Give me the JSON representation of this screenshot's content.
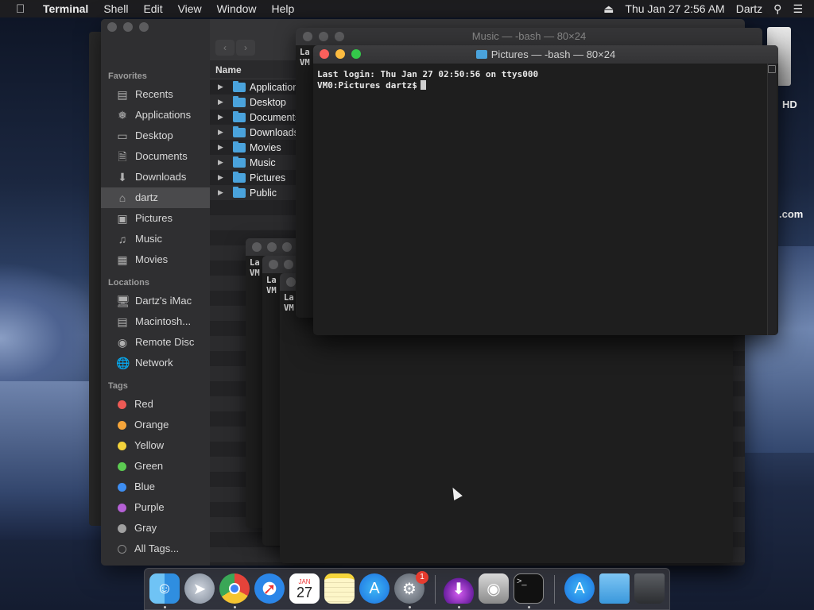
{
  "menubar": {
    "app": "Terminal",
    "menus": [
      "Shell",
      "Edit",
      "View",
      "Window",
      "Help"
    ],
    "clock": "Thu Jan 27  2:56 AM",
    "user": "Dartz"
  },
  "desktop": {
    "labels": [
      "HD",
      ".com"
    ]
  },
  "finder": {
    "column_header": "Name",
    "sidebar": {
      "favorites_header": "Favorites",
      "favorites": [
        "Recents",
        "Applications",
        "Desktop",
        "Documents",
        "Downloads",
        "dartz",
        "Pictures",
        "Music",
        "Movies"
      ],
      "locations_header": "Locations",
      "locations": [
        "Dartz's iMac",
        "Macintosh...",
        "Remote Disc",
        "Network"
      ],
      "tags_header": "Tags",
      "tags": [
        {
          "label": "Red",
          "color": "#ed5a55"
        },
        {
          "label": "Orange",
          "color": "#f5a53a"
        },
        {
          "label": "Yellow",
          "color": "#f3d33b"
        },
        {
          "label": "Green",
          "color": "#5ccb52"
        },
        {
          "label": "Blue",
          "color": "#3e8ef1"
        },
        {
          "label": "Purple",
          "color": "#b560d6"
        },
        {
          "label": "Gray",
          "color": "#a0a0a0"
        }
      ],
      "all_tags": "All Tags..."
    },
    "rows": [
      "Applications",
      "Desktop",
      "Documents",
      "Downloads",
      "Movies",
      "Music",
      "Pictures",
      "Public"
    ]
  },
  "bg_terminals": {
    "music_title": "Music — -bash — 80×24",
    "snippet_line1": "La",
    "snippet_line2": "VM"
  },
  "terminal": {
    "title": "Pictures — -bash — 80×24",
    "line1": "Last login: Thu Jan 27 02:50:56 on ttys000",
    "prompt": "VM0:Pictures dartz$"
  },
  "dock": {
    "calendar_month": "JAN",
    "calendar_day": "27",
    "app_store_badge": "1"
  }
}
